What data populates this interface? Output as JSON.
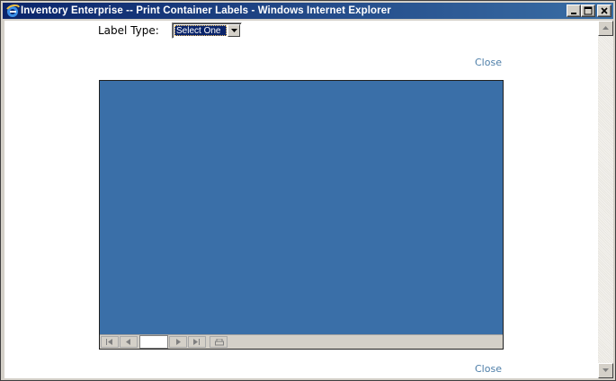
{
  "window": {
    "title": "Inventory Enterprise -- Print Container Labels - Windows Internet Explorer",
    "icon": "internet-explorer-icon",
    "controls": [
      "minimize-icon",
      "maximize-icon",
      "close-icon"
    ]
  },
  "form": {
    "label_type_label": "Label Type:",
    "label_type_selected": "Select One"
  },
  "links": {
    "close_top": "Close",
    "close_bottom": "Close"
  },
  "report_viewer": {
    "background_color": "#3a6fa8",
    "page_number": "",
    "toolbar_icons": [
      "first-page-icon",
      "previous-page-icon",
      "next-page-icon",
      "last-page-icon",
      "print-icon"
    ]
  },
  "colors": {
    "titlebar": "#0a246a",
    "link": "#4d7ea8"
  }
}
